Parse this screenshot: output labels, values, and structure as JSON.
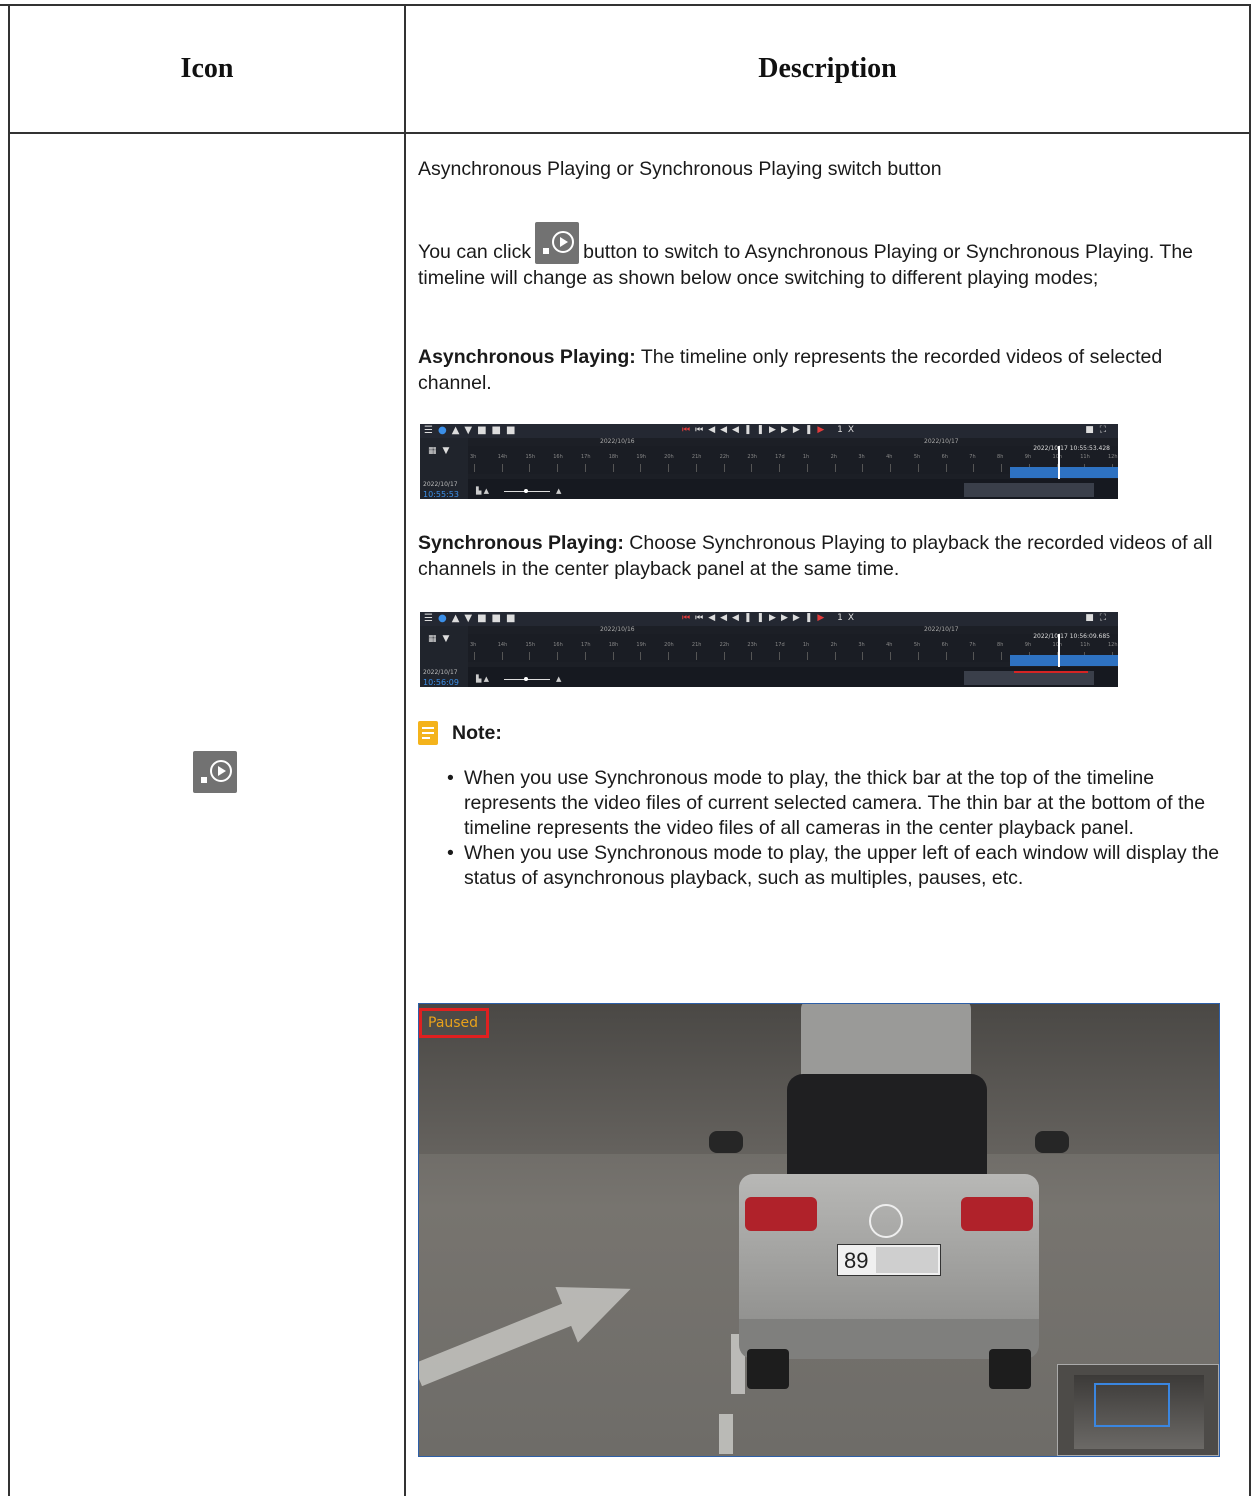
{
  "table": {
    "headers": {
      "icon": "Icon",
      "description": "Description"
    }
  },
  "row": {
    "icon_name": "sync-async-play-icon",
    "title": "Asynchronous Playing or Synchronous Playing switch button",
    "click_prefix": "You can click",
    "click_suffix": "button to switch to Asynchronous Playing or Synchronous Playing. The timeline will change as shown below once switching to different playing modes;",
    "async_label": "Asynchronous Playing:",
    "async_text": "The timeline only represents the recorded videos of selected channel.",
    "sync_label": "Synchronous Playing:",
    "sync_text": "Choose Synchronous Playing to playback the recorded videos of all channels in the center playback panel at the same time.",
    "note_title": "Note:",
    "notes": [
      "When you use Synchronous mode to play, the thick bar at the top of the timeline represents the video files of current selected camera. The thin bar at the bottom of the timeline represents the video files of all cameras in the center playback panel.",
      "When you use Synchronous mode to play, the upper left of each window will display the status of asynchronous playback, such as multiples, pauses, etc."
    ]
  },
  "timelines": [
    {
      "date_left": "2022/10/16",
      "date_right": "2022/10/17",
      "stamp": "2022/10/17 10:55:53.428",
      "side_date": "2022/10/17",
      "side_time": "10:55:53",
      "speed": "1X"
    },
    {
      "date_left": "2022/10/16",
      "date_right": "2022/10/17",
      "stamp": "2022/10/17 10:56:09.685",
      "side_date": "2022/10/17",
      "side_time": "10:56:09",
      "speed": "1X"
    }
  ],
  "hour_labels": [
    "3h",
    "14h",
    "15h",
    "16h",
    "17h",
    "18h",
    "19h",
    "20h",
    "21h",
    "22h",
    "23h",
    "17d",
    "1h",
    "2h",
    "3h",
    "4h",
    "5h",
    "6h",
    "7h",
    "8h",
    "9h",
    "10h",
    "11h",
    "12h"
  ],
  "camera": {
    "status": "Paused",
    "plate": "89"
  },
  "colors": {
    "accent_blue": "#2e72c2",
    "status_red": "#e02020",
    "note_yellow": "#f4b31b"
  }
}
